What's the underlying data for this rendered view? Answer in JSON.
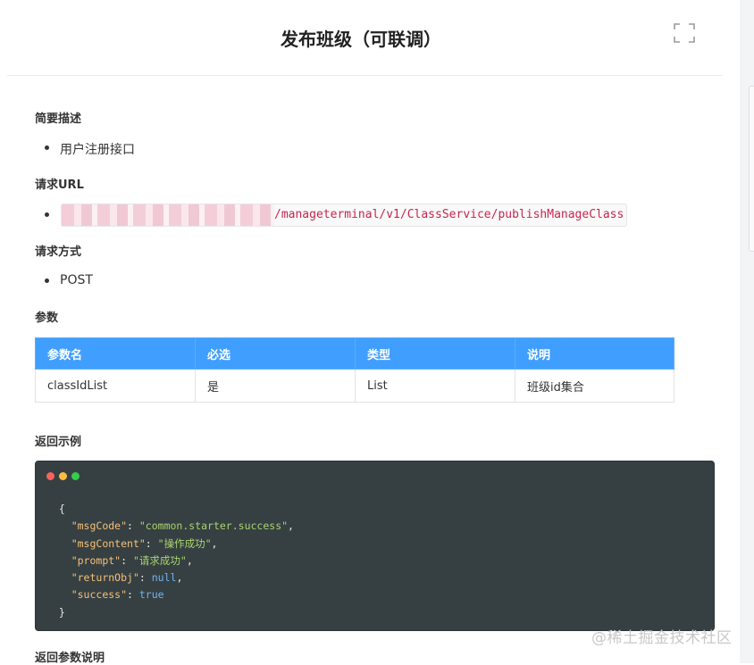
{
  "page": {
    "title": "发布班级（可联调）"
  },
  "sections": {
    "summary": {
      "heading": "简要描述",
      "items": [
        "用户注册接口"
      ]
    },
    "request_url": {
      "heading": "请求URL",
      "path": "/manageterminal/v1/ClassService/publishManageClass"
    },
    "request_method": {
      "heading": "请求方式",
      "items": [
        "POST"
      ]
    },
    "params": {
      "heading": "参数",
      "columns": [
        "参数名",
        "必选",
        "类型",
        "说明"
      ],
      "rows": [
        [
          "classIdList",
          "是",
          "List",
          "班级id集合"
        ]
      ]
    },
    "return_example": {
      "heading": "返回示例",
      "lines": [
        {
          "t": [
            [
              "p",
              "{"
            ]
          ]
        },
        {
          "t": [
            [
              "key",
              "\"msgCode\""
            ],
            [
              "p",
              ": "
            ],
            [
              "str",
              "\"common.starter.success\""
            ],
            [
              "p",
              ","
            ]
          ]
        },
        {
          "t": [
            [
              "key",
              "\"msgContent\""
            ],
            [
              "p",
              ": "
            ],
            [
              "str",
              "\"操作成功\""
            ],
            [
              "p",
              ","
            ]
          ]
        },
        {
          "t": [
            [
              "key",
              "\"prompt\""
            ],
            [
              "p",
              ": "
            ],
            [
              "str",
              "\"请求成功\""
            ],
            [
              "p",
              ","
            ]
          ]
        },
        {
          "t": [
            [
              "key",
              "\"returnObj\""
            ],
            [
              "p",
              ": "
            ],
            [
              "lit",
              "null"
            ],
            [
              "p",
              ","
            ]
          ]
        },
        {
          "t": [
            [
              "key",
              "\"success\""
            ],
            [
              "p",
              ": "
            ],
            [
              "lit",
              "true"
            ]
          ]
        },
        {
          "t": [
            [
              "p",
              "}"
            ]
          ]
        }
      ],
      "window_dots": [
        "#fc625d",
        "#fdbc40",
        "#35cd4b"
      ]
    },
    "return_params": {
      "heading": "返回参数说明"
    }
  },
  "icons": {
    "fullscreen": "fullscreen-icon"
  },
  "colors": {
    "table_header": "#409eff",
    "code_bg": "#364042",
    "url_text": "#c7254e"
  },
  "watermark": "@稀土掘金技术社区"
}
